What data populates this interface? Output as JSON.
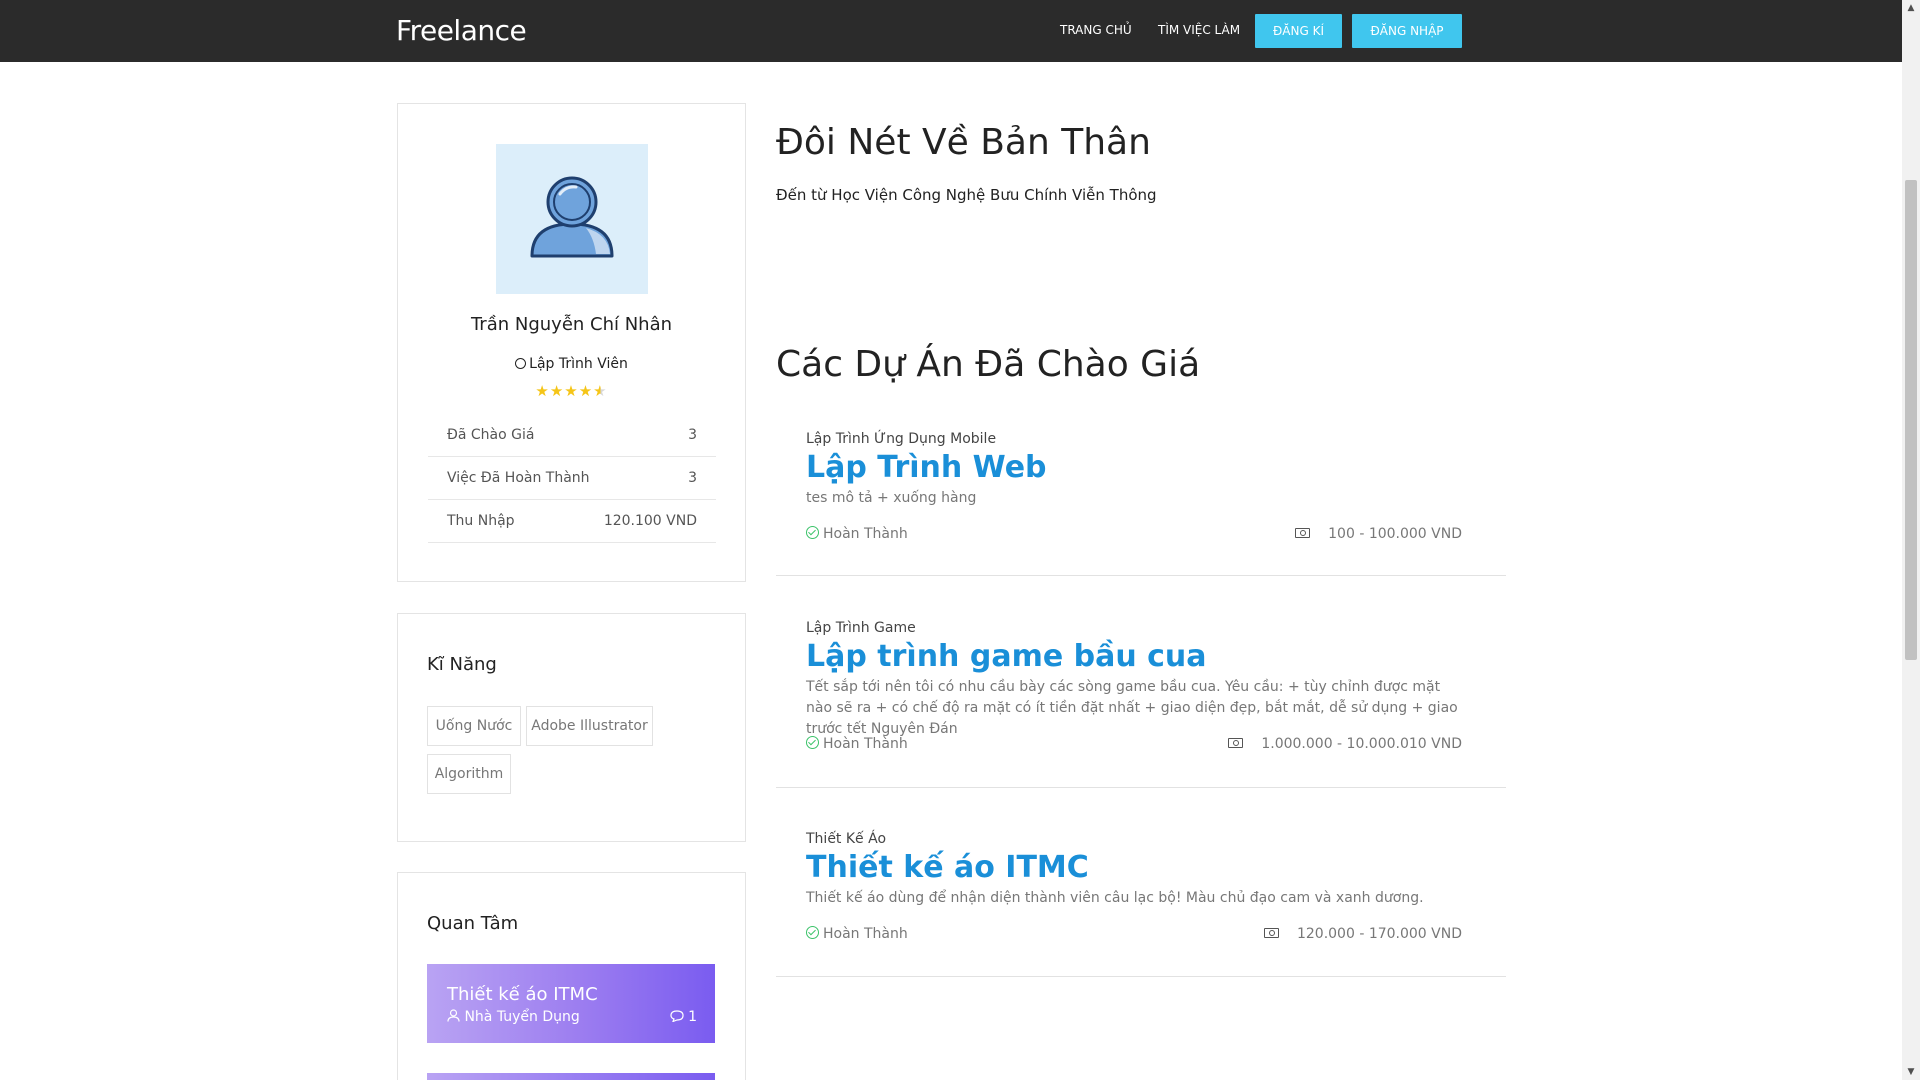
{
  "header": {
    "brand": "Freelance",
    "nav": [
      "TRANG CHỦ",
      "TÌM VIỆC LÀM"
    ],
    "register": "ĐĂNG KÍ",
    "login": "ĐĂNG NHẬP",
    "accent": "#40c6ee"
  },
  "profile": {
    "name": "Trần Nguyễn Chí Nhân",
    "role": "Lập Trình Viên",
    "rating": 4.5,
    "stats": [
      {
        "label": "Đã Chào Giá",
        "value": "3"
      },
      {
        "label": "Việc Đã Hoàn Thành",
        "value": "3"
      },
      {
        "label": "Thu Nhập",
        "value": "120.100 VND"
      }
    ]
  },
  "skills": {
    "title": "Kĩ Năng",
    "tags": [
      "Uống Nước",
      "Adobe Illustrator",
      "Algorithm"
    ]
  },
  "interest": {
    "title": "Quan Tâm",
    "items": [
      {
        "title": "Thiết kế áo ITMC",
        "owner": "Nhà Tuyển Dụng",
        "comments": "1"
      }
    ]
  },
  "about": {
    "heading": "Đôi Nét Về Bản Thân",
    "text": "Đến từ Học Viện Công Nghệ Bưu Chính Viễn Thông"
  },
  "projects": {
    "heading": "Các Dự Án Đã Chào Giá",
    "items": [
      {
        "category": "Lập Trình Ứng Dụng Mobile",
        "title": "Lập Trình Web",
        "desc": "tes mô tả + xuống hàng",
        "status": "Hoàn Thành",
        "budget": "100 - 100.000 VND"
      },
      {
        "category": "Lập Trình Game",
        "title": "Lập trình game bầu cua",
        "desc": "Tết sắp tới nên tôi có nhu cầu bày các sòng game bầu cua. Yêu cầu: + tùy chỉnh được mặt nào sẽ ra + có chế độ ra mặt có ít tiền đặt nhất + giao diện đẹp, bắt mắt, dễ sử dụng + giao trước tết Nguyên Đán",
        "status": "Hoàn Thành",
        "budget": "1.000.000 - 10.000.010 VND"
      },
      {
        "category": "Thiết Kế Áo",
        "title": "Thiết kế áo ITMC",
        "desc": "Thiết kế áo dùng để nhận diện thành viên câu lạc bộ! Màu chủ đạo cam và xanh dương.",
        "status": "Hoàn Thành",
        "budget": "120.000 - 170.000 VND"
      }
    ]
  }
}
